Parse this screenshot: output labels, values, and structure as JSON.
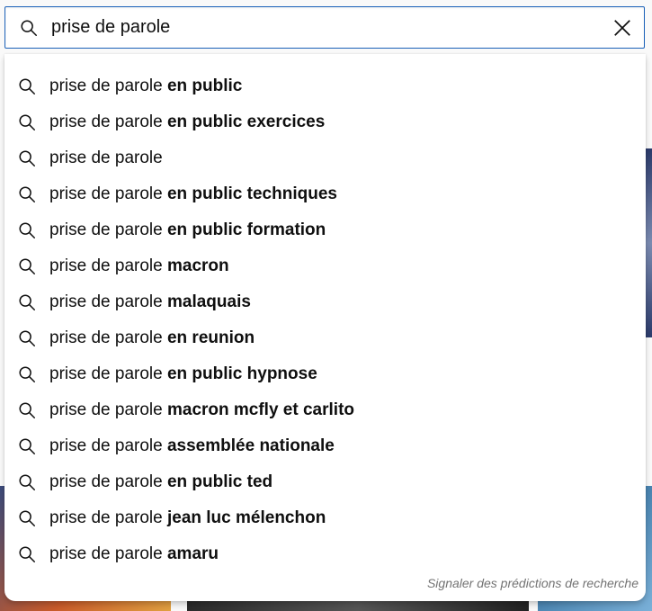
{
  "search": {
    "query": "prise de parole",
    "placeholder": ""
  },
  "suggestions": [
    {
      "prefix": "prise de parole",
      "completion": " en public"
    },
    {
      "prefix": "prise de parole",
      "completion": " en public exercices"
    },
    {
      "prefix": "prise de parole",
      "completion": ""
    },
    {
      "prefix": "prise de parole",
      "completion": " en public techniques"
    },
    {
      "prefix": "prise de parole",
      "completion": " en public formation"
    },
    {
      "prefix": "prise de parole",
      "completion": " macron"
    },
    {
      "prefix": "prise de parole",
      "completion": " malaquais"
    },
    {
      "prefix": "prise de parole",
      "completion": " en reunion"
    },
    {
      "prefix": "prise de parole",
      "completion": " en public hypnose"
    },
    {
      "prefix": "prise de parole",
      "completion": " macron mcfly et carlito"
    },
    {
      "prefix": "prise de parole",
      "completion": " assemblée nationale"
    },
    {
      "prefix": "prise de parole",
      "completion": " en public ted"
    },
    {
      "prefix": "prise de parole",
      "completion": " jean luc mélenchon"
    },
    {
      "prefix": "prise de parole",
      "completion": " amaru"
    }
  ],
  "report_label": "Signaler des prédictions de recherche",
  "icons": {
    "search": "search-icon",
    "clear": "close-icon"
  },
  "colors": {
    "focus_border": "#1c62b9",
    "text": "#0f0f0f",
    "muted": "#737373"
  }
}
